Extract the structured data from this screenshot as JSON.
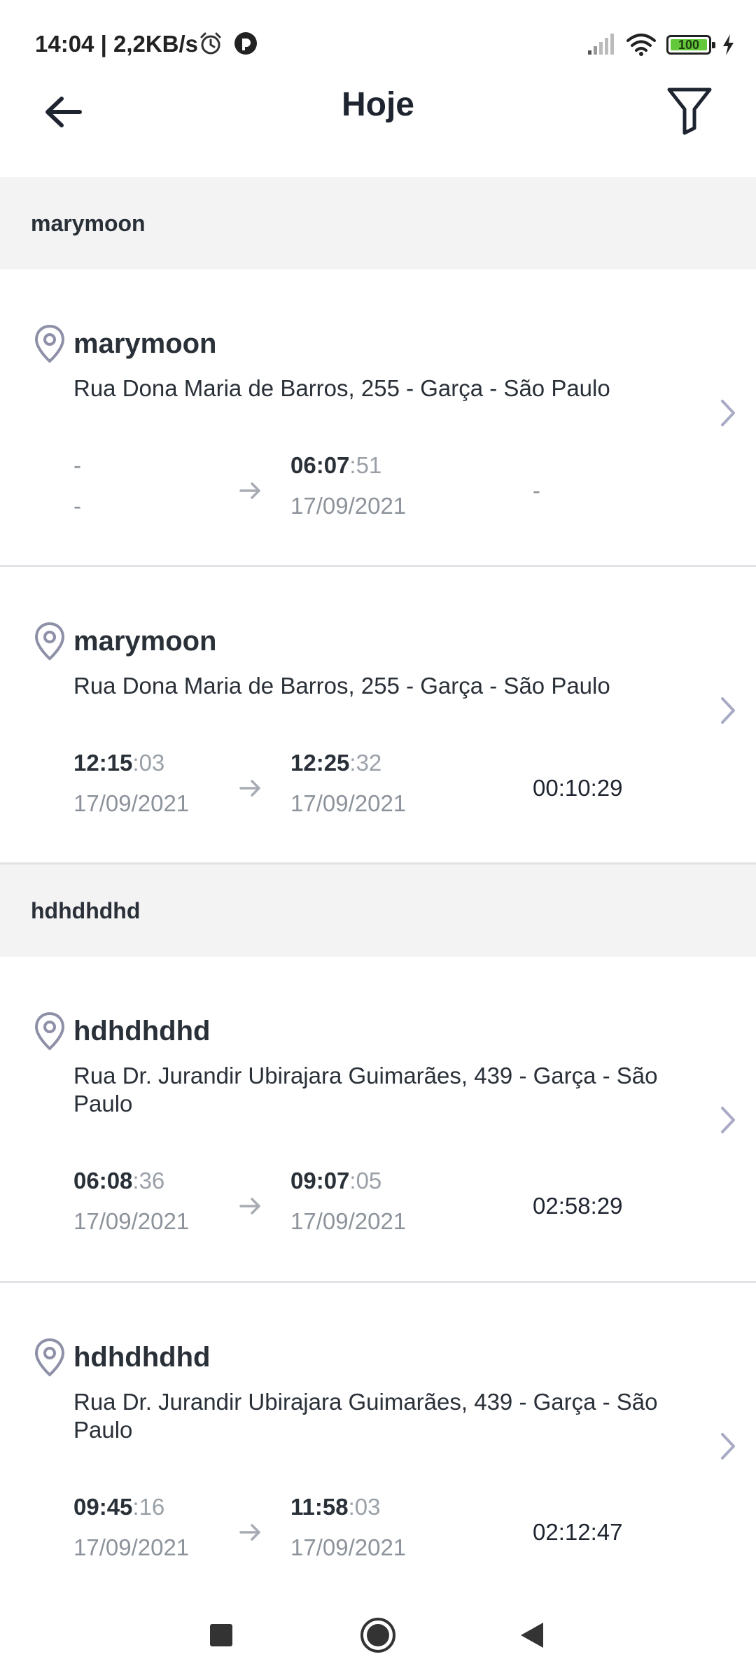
{
  "status_bar": {
    "time_speed": "14:04 | 2,2KB/s",
    "battery_level": "100",
    "icons": [
      "alarm-icon",
      "app-notification-icon",
      "signal-icon",
      "wifi-icon",
      "battery-icon",
      "charging-icon"
    ]
  },
  "header": {
    "title": "Hoje",
    "back_icon": "arrow-left-icon",
    "filter_icon": "filter-icon"
  },
  "colors": {
    "section_bg": "#f3f3f4",
    "pin": "#8e90a8",
    "chevron": "#a9abc6",
    "muted": "#9aa0a8",
    "divider": "#e1e3e6"
  },
  "groups": [
    {
      "name": "marymoon",
      "visits": [
        {
          "place": "marymoon",
          "address": "Rua Dona Maria de Barros, 255 - Garça - São Paulo",
          "start_hm": "-",
          "start_s": "",
          "start_date": "-",
          "end_hm": "06:07",
          "end_s": ":51",
          "end_date": "17/09/2021",
          "dur_hm": "-",
          "dur_s": ""
        },
        {
          "place": "marymoon",
          "address": "Rua Dona Maria de Barros, 255 - Garça - São Paulo",
          "start_hm": "12:15",
          "start_s": ":03",
          "start_date": "17/09/2021",
          "end_hm": "12:25",
          "end_s": ":32",
          "end_date": "17/09/2021",
          "dur_hm": "00:10",
          "dur_s": ":29"
        }
      ]
    },
    {
      "name": "hdhdhdhd",
      "visits": [
        {
          "place": "hdhdhdhd",
          "address": "Rua Dr. Jurandir Ubirajara Guimarães, 439 - Garça - São Paulo",
          "start_hm": "06:08",
          "start_s": ":36",
          "start_date": "17/09/2021",
          "end_hm": "09:07",
          "end_s": ":05",
          "end_date": "17/09/2021",
          "dur_hm": "02:58",
          "dur_s": ":29"
        },
        {
          "place": "hdhdhdhd",
          "address": "Rua Dr. Jurandir Ubirajara Guimarães, 439 - Garça - São Paulo",
          "start_hm": "09:45",
          "start_s": ":16",
          "start_date": "17/09/2021",
          "end_hm": "11:58",
          "end_s": ":03",
          "end_date": "17/09/2021",
          "dur_hm": "02:12",
          "dur_s": ":47"
        }
      ]
    }
  ],
  "nav_bar": {
    "buttons": [
      "recents-square-icon",
      "home-circle-icon",
      "back-triangle-icon"
    ]
  }
}
